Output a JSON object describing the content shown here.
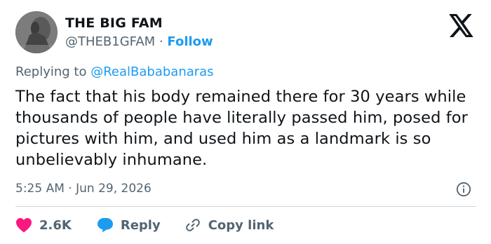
{
  "author": {
    "name": "THE BIG FAM",
    "handle": "@THEB1GFAM",
    "separator": "·",
    "follow_label": "Follow"
  },
  "reply": {
    "prefix": "Replying to",
    "mention": "@RealBababanaras"
  },
  "tweet": {
    "text": "The fact that his body remained there for 30 years while thousands of people have literally passed him, posed for pictures with him, and used him as a landmark is so unbelievably inhumane."
  },
  "meta": {
    "time": "5:25 AM",
    "separator": "·",
    "date": "Jun 29, 2026"
  },
  "actions": {
    "like_count": "2.6K",
    "reply_label": "Reply",
    "copy_label": "Copy link"
  },
  "icons": {
    "platform": "x-logo-icon",
    "info": "info-icon",
    "like": "heart-icon",
    "reply": "speech-bubble-icon",
    "copy": "link-icon"
  },
  "colors": {
    "accent": "#1d9bf0",
    "like": "#f91880",
    "secondary_text": "#536471",
    "divider": "#cfd9de"
  }
}
